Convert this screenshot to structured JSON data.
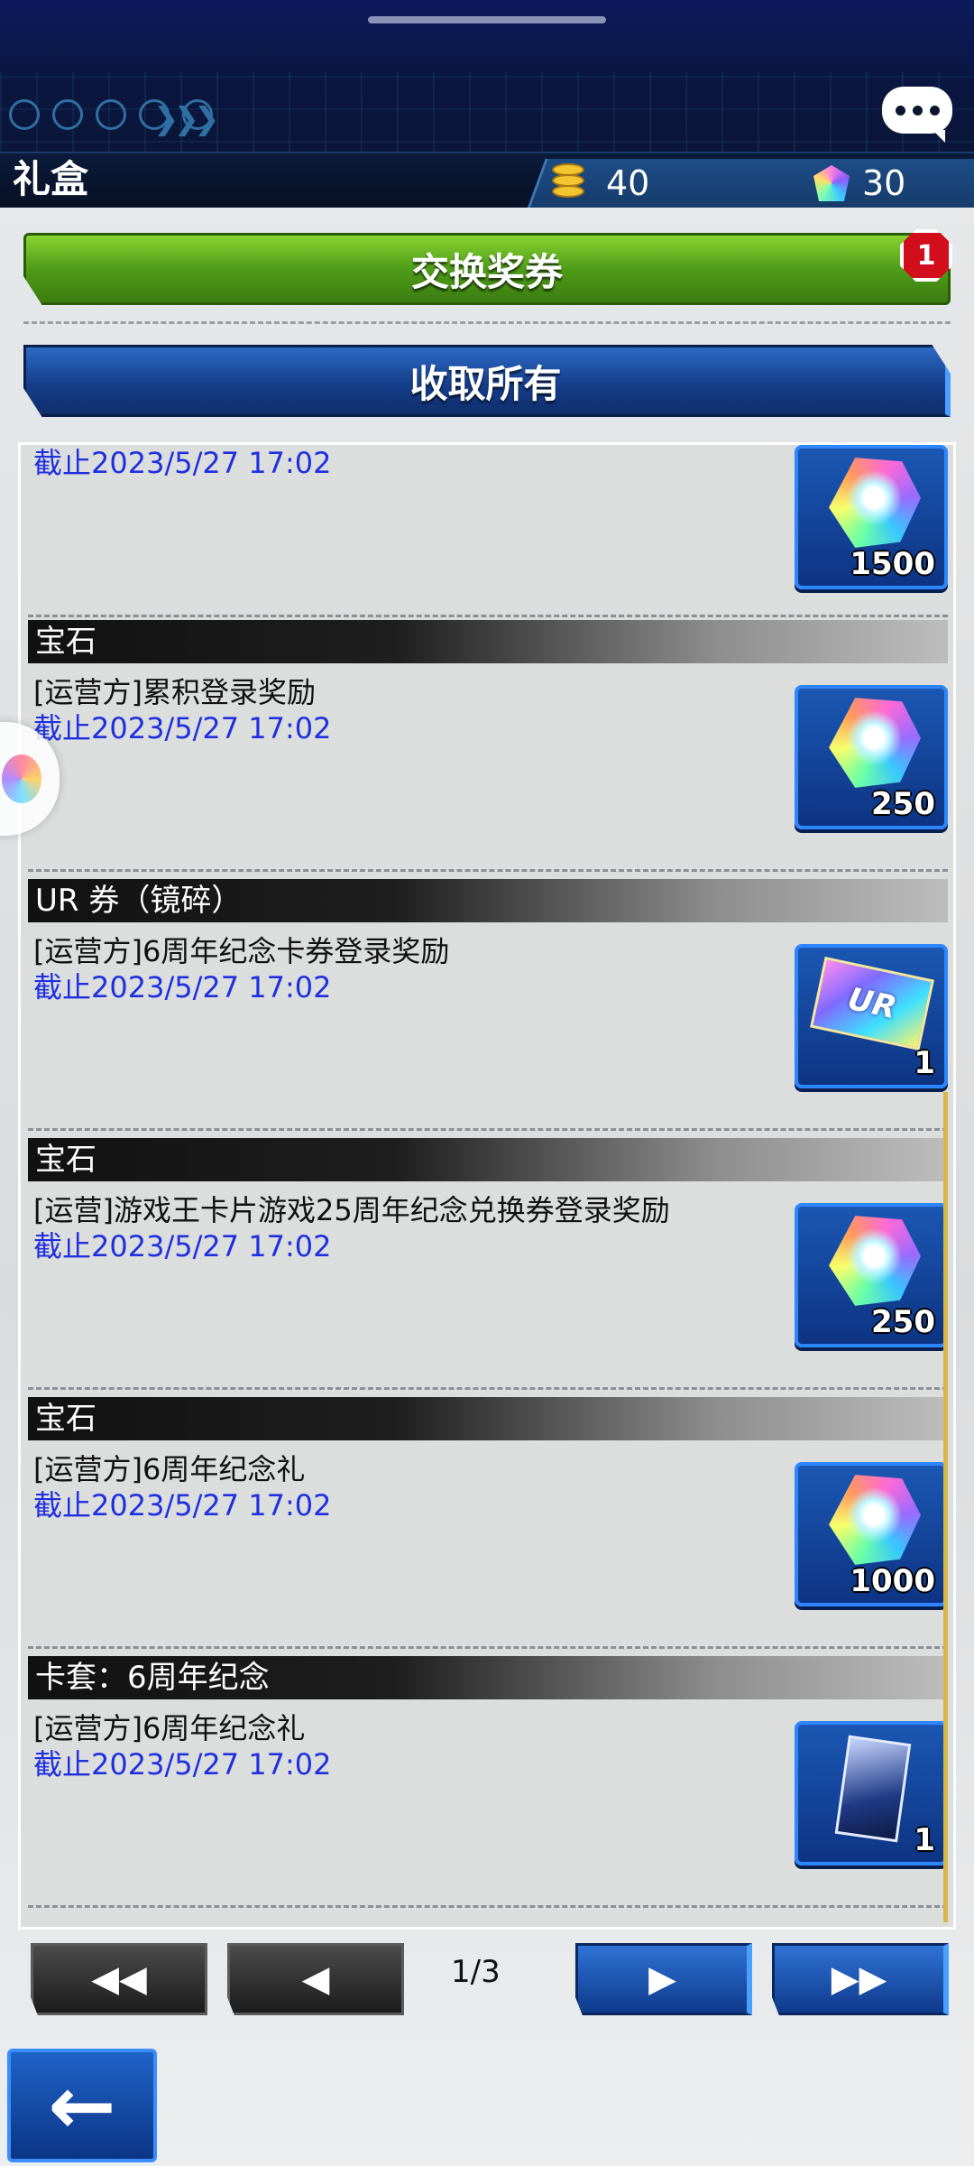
{
  "header": {
    "title": "礼盒",
    "coins": "40",
    "gems": "30"
  },
  "buttons": {
    "exchange": "交换奖券",
    "exchange_badge": "1",
    "collect_all": "收取所有"
  },
  "items": [
    {
      "category": "",
      "desc": "",
      "deadline": "截止2023/5/27 17:02",
      "reward": "gem",
      "qty": "1500"
    },
    {
      "category": "宝石",
      "desc": "[运营方]累积登录奖励",
      "deadline": "截止2023/5/27 17:02",
      "reward": "gem",
      "qty": "250"
    },
    {
      "category": "UR 券（镜碎）",
      "desc": "[运营方]6周年纪念卡券登录奖励",
      "deadline": "截止2023/5/27 17:02",
      "reward": "ticket",
      "reward_label": "UR",
      "qty": "1"
    },
    {
      "category": "宝石",
      "desc": "[运营]游戏王卡片游戏25周年纪念兑换券登录奖励",
      "deadline": "截止2023/5/27 17:02",
      "reward": "gem",
      "qty": "250"
    },
    {
      "category": "宝石",
      "desc": "[运营方]6周年纪念礼",
      "deadline": "截止2023/5/27 17:02",
      "reward": "gem",
      "qty": "1000"
    },
    {
      "category": "卡套：6周年纪念",
      "desc": "[运营方]6周年纪念礼",
      "deadline": "截止2023/5/27 17:02",
      "reward": "sleeve",
      "qty": "1"
    }
  ],
  "pagination": {
    "first": "◀◀",
    "prev": "◀",
    "next": "▶",
    "last": "▶▶",
    "label": "1/3"
  },
  "footer": {
    "back": "←"
  }
}
